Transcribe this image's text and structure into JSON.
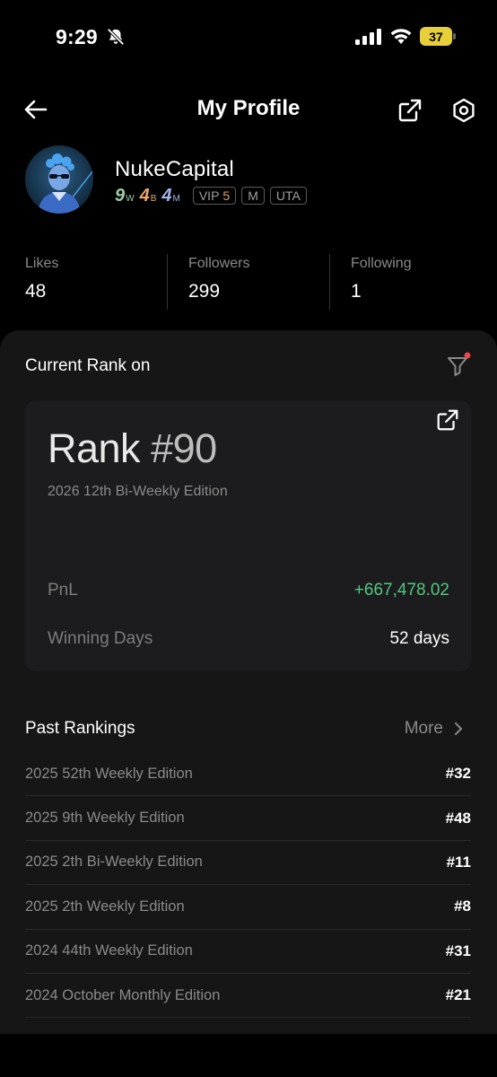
{
  "status_bar": {
    "time": "9:29",
    "battery_level": "37",
    "icons": [
      "bell-slash-icon",
      "signal-icon",
      "wifi-icon",
      "battery-icon"
    ],
    "battery_color": "#e7cf3a"
  },
  "header": {
    "title": "My Profile",
    "icons": [
      "back-arrow-icon",
      "share-icon",
      "settings-icon"
    ]
  },
  "profile": {
    "username": "NukeCapital",
    "badges": [
      {
        "num": "9",
        "sub": "W",
        "color": "#9fcfa8"
      },
      {
        "num": "4",
        "sub": "B",
        "color": "#e7a86d"
      },
      {
        "num": "4",
        "sub": "M",
        "color": "#9fb6e6"
      }
    ],
    "vip_label": "VIP",
    "vip_level": "5",
    "tags": [
      "M",
      "UTA"
    ]
  },
  "stats": [
    {
      "label": "Likes",
      "value": "48"
    },
    {
      "label": "Followers",
      "value": "299"
    },
    {
      "label": "Following",
      "value": "1"
    }
  ],
  "current_rank": {
    "section_title": "Current Rank on",
    "rank_label": "Rank",
    "rank_number": "#90",
    "edition": "2026 12th Bi-Weekly Edition",
    "pnl_label": "PnL",
    "pnl_value": "+667,478.02",
    "winning_days_label": "Winning Days",
    "winning_days_value": "52 days",
    "pnl_color": "#51c77f",
    "filter_dot_color": "#e5484d"
  },
  "past_rankings": {
    "title": "Past Rankings",
    "more_label": "More",
    "rows": [
      {
        "edition": "2025 52th Weekly Edition",
        "rank": "#32"
      },
      {
        "edition": "2025 9th Weekly Edition",
        "rank": "#48"
      },
      {
        "edition": "2025 2th Bi-Weekly Edition",
        "rank": "#11"
      },
      {
        "edition": "2025 2th Weekly Edition",
        "rank": "#8"
      },
      {
        "edition": "2024 44th Weekly Edition",
        "rank": "#31"
      },
      {
        "edition": "2024 October Monthly Edition",
        "rank": "#21"
      }
    ]
  }
}
